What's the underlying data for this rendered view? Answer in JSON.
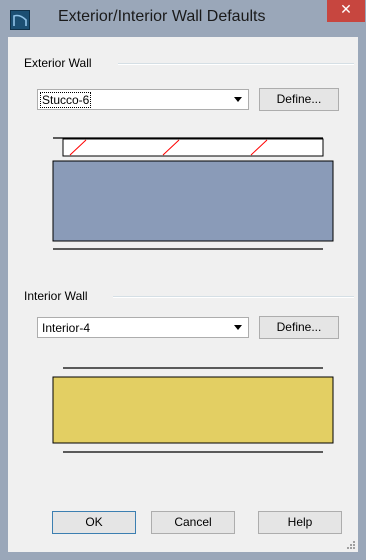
{
  "window": {
    "title": "Exterior/Interior Wall Defaults",
    "close_glyph": "✕",
    "icon": "app-logo-icon"
  },
  "exterior": {
    "group_label": "Exterior Wall",
    "selected_wall": "Stucco-6",
    "define_label": "Define...",
    "fill_color": "#8a9bb8",
    "outer_layer_color": "#ffffff",
    "hatch_color": "#ff0000"
  },
  "interior": {
    "group_label": "Interior Wall",
    "selected_wall": "Interior-4",
    "define_label": "Define...",
    "fill_color": "#e3cf63"
  },
  "buttons": {
    "ok": "OK",
    "cancel": "Cancel",
    "help": "Help"
  }
}
